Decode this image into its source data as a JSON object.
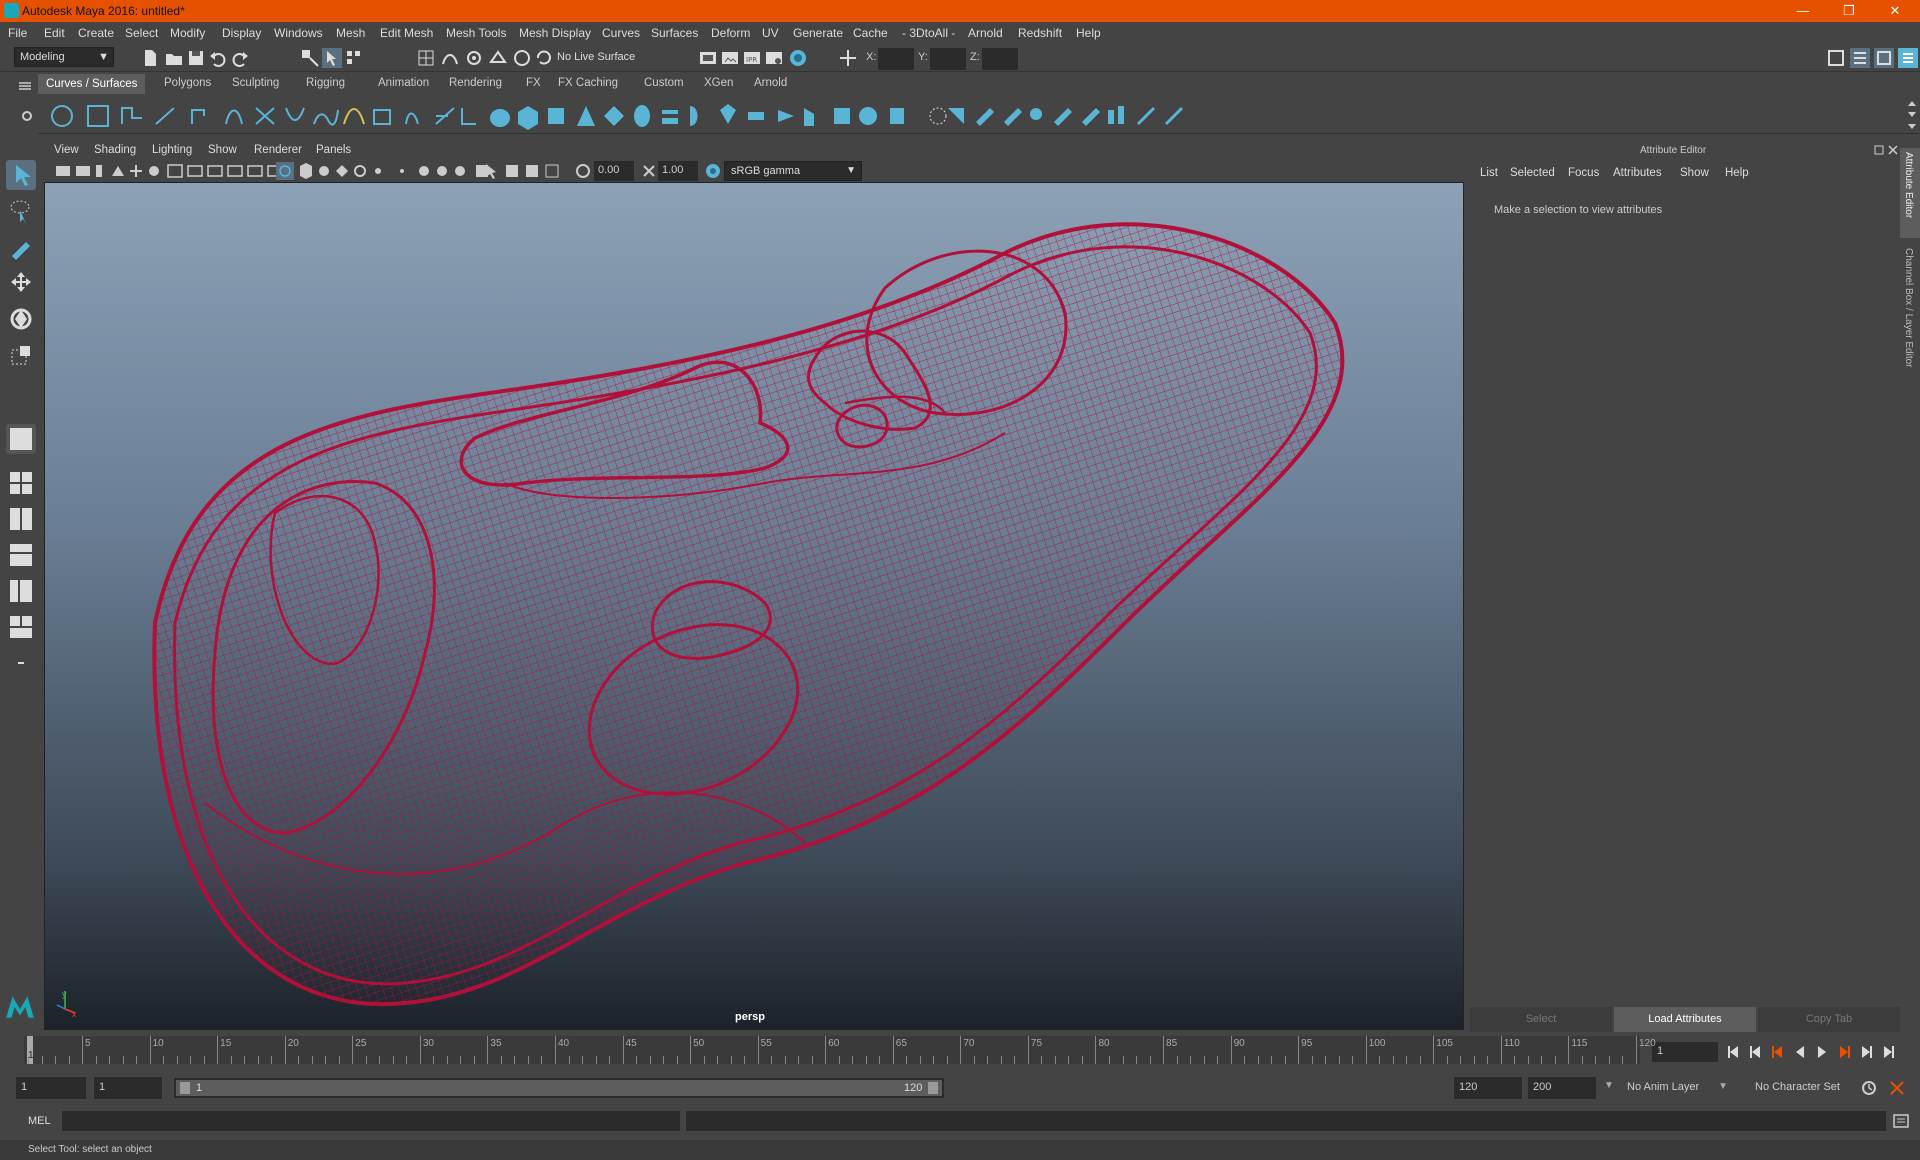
{
  "window": {
    "title": "Autodesk Maya 2016: untitled*"
  },
  "menubar": [
    "File",
    "Edit",
    "Create",
    "Select",
    "Modify",
    "Display",
    "Windows",
    "Mesh",
    "Edit Mesh",
    "Mesh Tools",
    "Mesh Display",
    "Curves",
    "Surfaces",
    "Deform",
    "UV",
    "Generate",
    "Cache",
    "- 3DtoAll -",
    "Arnold",
    "Redshift",
    "Help"
  ],
  "status": {
    "mode": "Modeling",
    "live_surface": "No Live Surface",
    "x_label": "X:",
    "y_label": "Y:",
    "z_label": "Z:"
  },
  "shelf_tabs": [
    "Curves / Surfaces",
    "Polygons",
    "Sculpting",
    "Rigging",
    "Animation",
    "Rendering",
    "FX",
    "FX Caching",
    "Custom",
    "XGen",
    "Arnold"
  ],
  "active_shelf_tab": "Curves / Surfaces",
  "viewport": {
    "menu": [
      "View",
      "Shading",
      "Lighting",
      "Show",
      "Renderer",
      "Panels"
    ],
    "exposure": "0.00",
    "gamma": "1.00",
    "color_space": "sRGB gamma",
    "camera_label": "persp",
    "axis_x": "x",
    "axis_y": "y"
  },
  "attribute_editor": {
    "title": "Attribute Editor",
    "menu": [
      "List",
      "Selected",
      "Focus",
      "Attributes",
      "Show",
      "Help"
    ],
    "message": "Make a selection to view attributes",
    "buttons": {
      "select": "Select",
      "load": "Load Attributes",
      "copy": "Copy Tab"
    },
    "side_tabs": [
      "Attribute Editor",
      "Channel Box / Layer Editor"
    ]
  },
  "timeline": {
    "ticks": [
      "5",
      "10",
      "15",
      "20",
      "25",
      "30",
      "35",
      "40",
      "45",
      "50",
      "55",
      "60",
      "65",
      "70",
      "75",
      "80",
      "85",
      "90",
      "95",
      "100",
      "105",
      "110",
      "115",
      "120"
    ],
    "start_tick": "1",
    "current_frame": "1"
  },
  "range": {
    "start": "1",
    "playback_start": "1",
    "slider_start": "1",
    "slider_end": "120",
    "playback_end": "120",
    "end": "200",
    "anim_layer": "No Anim Layer",
    "character_set": "No Character Set"
  },
  "command_line": {
    "label": "MEL"
  },
  "help_line": "Select Tool: select an object",
  "colors": {
    "title_bar": "#e65100",
    "wireframe": "#b0103a",
    "accent": "#5ab4d6"
  }
}
